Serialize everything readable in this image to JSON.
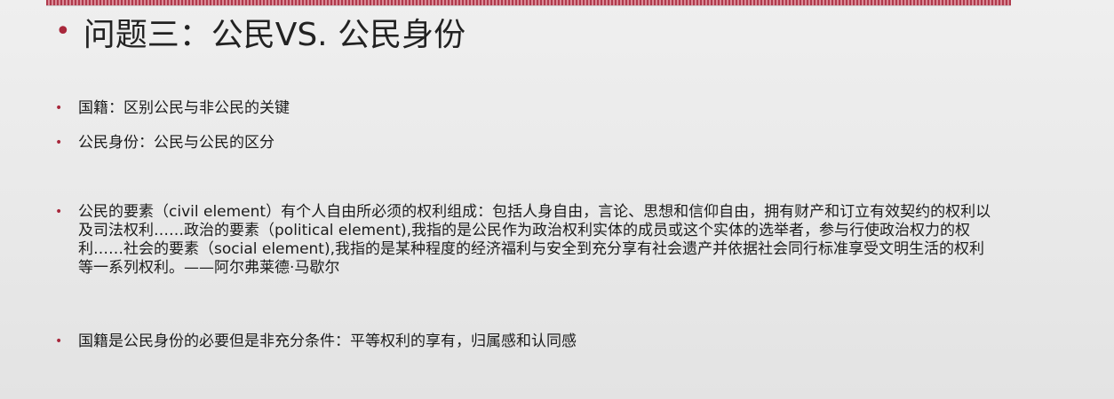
{
  "slide": {
    "title": "问题三：公民VS. 公民身份",
    "bullets": [
      "国籍：区别公民与非公民的关键",
      "公民身份：公民与公民的区分",
      "公民的要素（civil element）有个人自由所必须的权利组成：包括人身自由，言论、思想和信仰自由，拥有财产和订立有效契约的权利以及司法权利……政治的要素（political element),我指的是公民作为政治权利实体的成员或这个实体的选举者，参与行使政治权力的权利……社会的要素（social element),我指的是某种程度的经济福利与安全到充分享有社会遗产并依据社会同行标准享受文明生活的权利等一系列权利。——阿尔弗莱德·马歇尔",
      "国籍是公民身份的必要但是非充分条件：平等权利的享有，归属感和认同感"
    ]
  },
  "colors": {
    "accent": "#a8273b",
    "background": "#e9e9e9",
    "text": "#1c1c1c"
  }
}
